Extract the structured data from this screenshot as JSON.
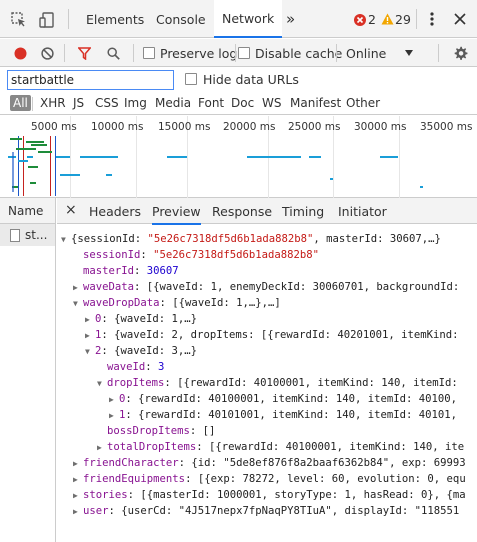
{
  "devtools": {
    "tabs": [
      "Elements",
      "Console",
      "Network"
    ],
    "more_tabs": "»",
    "errors": "2",
    "warnings": "29",
    "active_tab": "Network"
  },
  "toolbar": {
    "preserve_log": "Preserve log",
    "disable_cache": "Disable cache",
    "throttle": "Online"
  },
  "filter": {
    "value": "startbattle",
    "hide_data_urls": "Hide data URLs",
    "types": [
      "All",
      "XHR",
      "JS",
      "CSS",
      "Img",
      "Media",
      "Font",
      "Doc",
      "WS",
      "Manifest",
      "Other"
    ]
  },
  "overview": {
    "ticks": [
      "5000 ms",
      "10000 ms",
      "15000 ms",
      "20000 ms",
      "25000 ms",
      "30000 ms",
      "35000 ms"
    ]
  },
  "requests": {
    "header": "Name",
    "items": [
      "st..."
    ]
  },
  "detail": {
    "close": "×",
    "tabs": [
      "Headers",
      "Preview",
      "Response",
      "Timing",
      "Initiator"
    ],
    "active": "Preview"
  },
  "preview": {
    "lines": [
      {
        "indent": 0,
        "tri": "▼",
        "parts": [
          [
            "t",
            "{sessionId: "
          ],
          [
            "s",
            "\"5e26c7318df5d6b1ada882b8\""
          ],
          [
            "t",
            ", masterId: 30607,…}"
          ]
        ]
      },
      {
        "indent": 1,
        "tri": "",
        "parts": [
          [
            "k",
            "sessionId"
          ],
          [
            "t",
            ": "
          ],
          [
            "s",
            "\"5e26c7318df5d6b1ada882b8\""
          ]
        ]
      },
      {
        "indent": 1,
        "tri": "",
        "parts": [
          [
            "k",
            "masterId"
          ],
          [
            "t",
            ": "
          ],
          [
            "n",
            "30607"
          ]
        ]
      },
      {
        "indent": 1,
        "tri": "▶",
        "parts": [
          [
            "k",
            "waveData"
          ],
          [
            "t",
            ": [{waveId: 1, enemyDeckId: 30060701, backgroundId: "
          ]
        ]
      },
      {
        "indent": 1,
        "tri": "▼",
        "parts": [
          [
            "k",
            "waveDropData"
          ],
          [
            "t",
            ": [{waveId: 1,…},…]"
          ]
        ]
      },
      {
        "indent": 2,
        "tri": "▶",
        "parts": [
          [
            "k",
            "0"
          ],
          [
            "t",
            ": {waveId: 1,…}"
          ]
        ]
      },
      {
        "indent": 2,
        "tri": "▶",
        "parts": [
          [
            "k",
            "1"
          ],
          [
            "t",
            ": {waveId: 2, dropItems: [{rewardId: 40201001, itemKind: "
          ]
        ]
      },
      {
        "indent": 2,
        "tri": "▼",
        "parts": [
          [
            "k",
            "2"
          ],
          [
            "t",
            ": {waveId: 3,…}"
          ]
        ]
      },
      {
        "indent": 3,
        "tri": "",
        "parts": [
          [
            "k",
            "waveId"
          ],
          [
            "t",
            ": "
          ],
          [
            "n",
            "3"
          ]
        ]
      },
      {
        "indent": 3,
        "tri": "▼",
        "parts": [
          [
            "k",
            "dropItems"
          ],
          [
            "t",
            ": [{rewardId: 40100001, itemKind: 140, itemId: "
          ]
        ]
      },
      {
        "indent": 4,
        "tri": "▶",
        "parts": [
          [
            "k",
            "0"
          ],
          [
            "t",
            ": {rewardId: 40100001, itemKind: 140, itemId: 40100,"
          ]
        ]
      },
      {
        "indent": 4,
        "tri": "▶",
        "parts": [
          [
            "k",
            "1"
          ],
          [
            "t",
            ": {rewardId: 40101001, itemKind: 140, itemId: 40101,"
          ]
        ]
      },
      {
        "indent": 3,
        "tri": "",
        "parts": [
          [
            "k",
            "bossDropItems"
          ],
          [
            "t",
            ": []"
          ]
        ]
      },
      {
        "indent": 3,
        "tri": "▶",
        "parts": [
          [
            "k",
            "totalDropItems"
          ],
          [
            "t",
            ": [{rewardId: 40100001, itemKind: 140, ite"
          ]
        ]
      },
      {
        "indent": 1,
        "tri": "▶",
        "parts": [
          [
            "k",
            "friendCharacter"
          ],
          [
            "t",
            ": {id: \"5de8ef876f8a2baaf6362b84\", exp: 69993"
          ]
        ]
      },
      {
        "indent": 1,
        "tri": "▶",
        "parts": [
          [
            "k",
            "friendEquipments"
          ],
          [
            "t",
            ": [{exp: 78272, level: 60, evolution: 0, equ"
          ]
        ]
      },
      {
        "indent": 1,
        "tri": "▶",
        "parts": [
          [
            "k",
            "stories"
          ],
          [
            "t",
            ": [{masterId: 1000001, storyType: 1, hasRead: 0}, {ma"
          ]
        ]
      },
      {
        "indent": 1,
        "tri": "▶",
        "parts": [
          [
            "k",
            "user"
          ],
          [
            "t",
            ": {userCd: \"4J517nepx7fpNaqPY8TIuA\", displayId: \"118551"
          ]
        ]
      }
    ]
  }
}
